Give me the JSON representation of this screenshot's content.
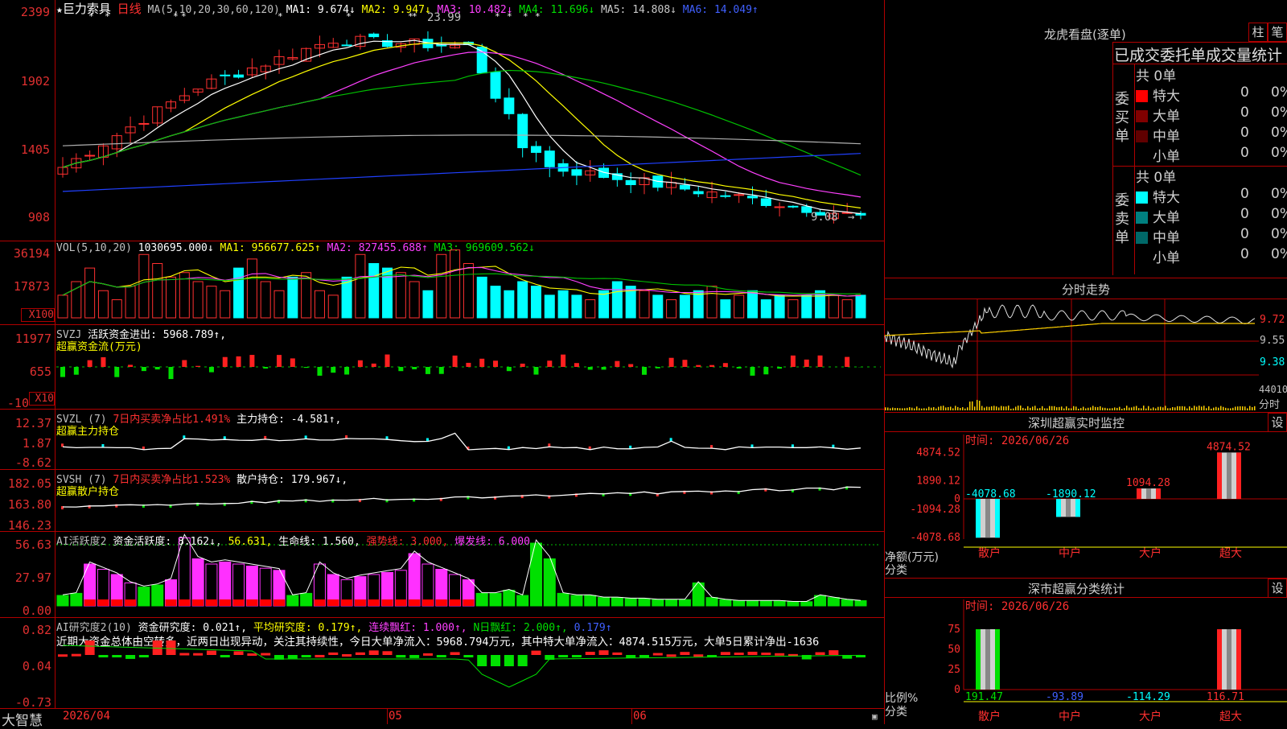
{
  "stock": {
    "name": "巨力索具",
    "period": "日线",
    "star": "★"
  },
  "ma_header": {
    "label": "MA(5,10,20,30,60,120)",
    "items": [
      {
        "text": "MA1: 9.674↓",
        "color": "#ffffff"
      },
      {
        "text": "MA2: 9.947↓",
        "color": "#ffff00"
      },
      {
        "text": "MA3: 10.482↓",
        "color": "#ff40ff"
      },
      {
        "text": "MA4: 11.696↓",
        "color": "#00e000"
      },
      {
        "text": "MA5: 14.808↓",
        "color": "#c8c8c8"
      },
      {
        "text": "MA6: 14.049↑",
        "color": "#4060ff"
      }
    ]
  },
  "price_axis": [
    "2399",
    "1902",
    "1405",
    "908"
  ],
  "price_annotations": {
    "high": "23.99",
    "low": "9.08"
  },
  "vol_header": {
    "label": "VOL(5,10,20)",
    "value": "1030695.000↓",
    "ma1": "MA1: 956677.625↑",
    "ma2": "MA2: 827455.688↑",
    "ma3": "MA3: 969609.562↓"
  },
  "vol_axis": [
    "36194",
    "17873",
    "X100"
  ],
  "svzj": {
    "label": "SVZJ",
    "desc": "活跃资金进出: 5968.789↑,",
    "sub": "超赢资金流(万元)",
    "axis": [
      "11977",
      "655",
      "-10",
      "X10"
    ]
  },
  "svzl": {
    "label": "SVZL (7)",
    "desc1": "7日内买卖净占比1.491%",
    "desc2": "主力持仓: -4.581↑,",
    "sub": "超赢主力持仓",
    "axis": [
      "12.37",
      "1.87",
      "-8.62"
    ]
  },
  "svsh": {
    "label": "SVSH (7)",
    "desc1": "7日内买卖净占比1.523%",
    "desc2": "散户持仓: 179.967↓,",
    "sub": "超赢散户持仓",
    "axis": [
      "182.05",
      "163.80",
      "146.23"
    ]
  },
  "ai_active": {
    "label": "AI活跃度2",
    "desc": "资金活跃度: 8.162↓,",
    "v2": "56.631,",
    "v3": "生命线: 1.560,",
    "v4": "强势线: 3.000,",
    "v5": "爆发线: 6.000,",
    "axis": [
      "56.63",
      "27.97",
      "0.00"
    ]
  },
  "ai_research": {
    "label": "AI研究度2(10)",
    "desc": "资金研究度: 0.021↑,",
    "v2": "平均研究度: 0.179↑,",
    "v3": "连续飘红: 1.000↑,",
    "v4": "N日飘红: 2.000↑,",
    "v5": "0.179↑",
    "comment": "近期大资金总体由空转多，近两日出现异动，关注其持续性，今日大单净流入：5968.794万元，其中特大单净流入：4874.515万元，大单5日累计净出-1636",
    "axis": [
      "0.82",
      "0.04",
      "-0.73"
    ]
  },
  "date_axis": {
    "d1": "2026/04",
    "d2": "05",
    "d3": "06"
  },
  "brand": "大智慧",
  "lhb": {
    "title": "龙虎看盘(逐单)",
    "tab1": "柱",
    "tab2": "笔",
    "header": "已成交委托单成交量统计",
    "buy": {
      "side": "委买单",
      "total": "共 0单",
      "rows": [
        {
          "name": "特大",
          "v": "0",
          "p": "0%",
          "color": "#ff0000"
        },
        {
          "name": "大单",
          "v": "0",
          "p": "0%",
          "color": "#800000"
        },
        {
          "name": "中单",
          "v": "0",
          "p": "0%",
          "color": "#600000"
        },
        {
          "name": "小单",
          "v": "0",
          "p": "0%",
          "color": "#000000"
        }
      ]
    },
    "sell": {
      "side": "委卖单",
      "total": "共 0单",
      "rows": [
        {
          "name": "特大",
          "v": "0",
          "p": "0%",
          "color": "#00ffff"
        },
        {
          "name": "大单",
          "v": "0",
          "p": "0%",
          "color": "#008080"
        },
        {
          "name": "中单",
          "v": "0",
          "p": "0%",
          "color": "#006868"
        },
        {
          "name": "小单",
          "v": "0",
          "p": "0%",
          "color": "#000000"
        }
      ]
    }
  },
  "fenshi": {
    "title": "分时走势",
    "axis": [
      "9.72",
      "9.55",
      "9.38"
    ],
    "vol": "44010",
    "vol_unit": "分时"
  },
  "sz_monitor": {
    "title": "深圳超赢实时监控",
    "set": "设",
    "time": "时间: 2026/06/26",
    "axis": [
      "4874.52",
      "1890.12",
      "0",
      "-1094.28",
      "-4078.68"
    ],
    "ylabel1": "净额(万元)",
    "ylabel2": "分类",
    "cats": [
      "散户",
      "中户",
      "大户",
      "超大"
    ],
    "values": [
      -4078.68,
      -1890.12,
      1094.28,
      4874.52
    ],
    "value_labels": [
      "-4078.68",
      "-1890.12",
      "1094.28",
      "4874.52"
    ]
  },
  "sz_stats": {
    "title": "深市超赢分类统计",
    "set": "设",
    "time": "时间: 2026/06/26",
    "axis": [
      "75",
      "50",
      "25",
      "0"
    ],
    "ylabel1": "比例%",
    "ylabel2": "分类",
    "cats": [
      "散户",
      "中户",
      "大户",
      "超大"
    ],
    "values": [
      191.47,
      -93.89,
      -114.29,
      116.71
    ],
    "value_labels": [
      "191.47",
      "-93.89",
      "-114.29",
      "116.71"
    ]
  }
}
